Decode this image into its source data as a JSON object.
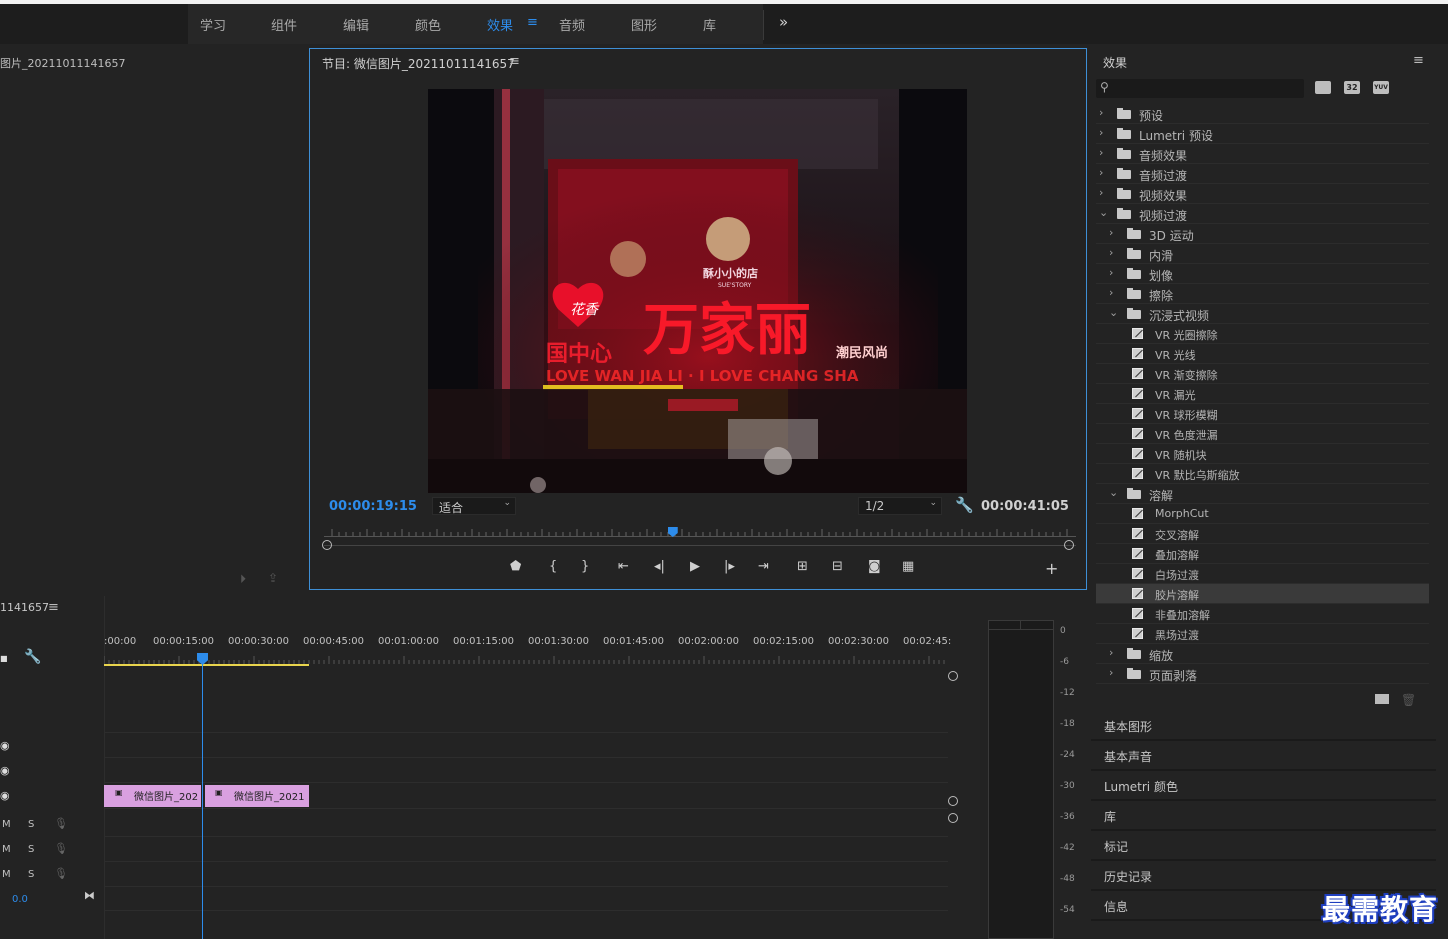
{
  "workspace": {
    "tabs": [
      "学习",
      "组件",
      "编辑",
      "颜色",
      "效果",
      "音频",
      "图形",
      "库"
    ],
    "active_index": 4,
    "overflow_icon": "double-chevron-right"
  },
  "source_panel": {
    "title": "图片_20211011141657"
  },
  "program_monitor": {
    "title": "节目: 微信图片_20211011141657",
    "current_time": "00:00:19:15",
    "fit_option": "适合",
    "resolution": "1/2",
    "duration": "00:00:41:05",
    "playhead_fraction": 0.47
  },
  "video_frame": {
    "sign_main": "万家丽",
    "sign_small": "花香",
    "store_name": "酥小小的店",
    "store_sub": "SUE'STORY",
    "sign_line2": "LOVE WAN JIA LI · I LOVE CHANG SHA",
    "sign_right": "潮民风尚",
    "sign_left": "国中心"
  },
  "effects_panel": {
    "title": "效果",
    "badges": [
      "32",
      "YUV"
    ],
    "tree": [
      {
        "label": "预设",
        "level": 0,
        "type": "preset-folder",
        "expanded": false
      },
      {
        "label": "Lumetri 预设",
        "level": 0,
        "type": "preset-folder",
        "expanded": false
      },
      {
        "label": "音频效果",
        "level": 0,
        "type": "folder",
        "expanded": false
      },
      {
        "label": "音频过渡",
        "level": 0,
        "type": "folder",
        "expanded": false
      },
      {
        "label": "视频效果",
        "level": 0,
        "type": "folder",
        "expanded": false
      },
      {
        "label": "视频过渡",
        "level": 0,
        "type": "folder",
        "expanded": true
      },
      {
        "label": "3D 运动",
        "level": 1,
        "type": "folder",
        "expanded": false
      },
      {
        "label": "内滑",
        "level": 1,
        "type": "folder",
        "expanded": false
      },
      {
        "label": "划像",
        "level": 1,
        "type": "folder",
        "expanded": false
      },
      {
        "label": "擦除",
        "level": 1,
        "type": "folder",
        "expanded": false
      },
      {
        "label": "沉浸式视频",
        "level": 1,
        "type": "folder",
        "expanded": true
      },
      {
        "label": "VR 光圈擦除",
        "level": 2,
        "type": "effect"
      },
      {
        "label": "VR 光线",
        "level": 2,
        "type": "effect"
      },
      {
        "label": "VR 渐变擦除",
        "level": 2,
        "type": "effect"
      },
      {
        "label": "VR 漏光",
        "level": 2,
        "type": "effect"
      },
      {
        "label": "VR 球形模糊",
        "level": 2,
        "type": "effect"
      },
      {
        "label": "VR 色度泄漏",
        "level": 2,
        "type": "effect"
      },
      {
        "label": "VR 随机块",
        "level": 2,
        "type": "effect"
      },
      {
        "label": "VR 默比乌斯缩放",
        "level": 2,
        "type": "effect"
      },
      {
        "label": "溶解",
        "level": 1,
        "type": "folder",
        "expanded": true
      },
      {
        "label": "MorphCut",
        "level": 2,
        "type": "effect"
      },
      {
        "label": "交叉溶解",
        "level": 2,
        "type": "effect"
      },
      {
        "label": "叠加溶解",
        "level": 2,
        "type": "effect"
      },
      {
        "label": "白场过渡",
        "level": 2,
        "type": "effect"
      },
      {
        "label": "胶片溶解",
        "level": 2,
        "type": "effect",
        "selected": true
      },
      {
        "label": "非叠加溶解",
        "level": 2,
        "type": "effect"
      },
      {
        "label": "黑场过渡",
        "level": 2,
        "type": "effect"
      },
      {
        "label": "缩放",
        "level": 1,
        "type": "folder",
        "expanded": false
      },
      {
        "label": "页面剥落",
        "level": 1,
        "type": "folder",
        "expanded": false
      }
    ]
  },
  "stacked_panels": [
    "基本图形",
    "基本声音",
    "Lumetri 颜色",
    "库",
    "标记",
    "历史记录",
    "信息"
  ],
  "timeline": {
    "title": "1141657",
    "ruler_labels": [
      ":00:00",
      "00:00:15:00",
      "00:00:30:00",
      "00:00:45:00",
      "00:01:00:00",
      "00:01:15:00",
      "00:01:30:00",
      "00:01:45:00",
      "00:02:00:00",
      "00:02:15:00",
      "00:02:30:00",
      "00:02:45:"
    ],
    "clips": [
      "微信图片_202",
      "微信图片_2021"
    ],
    "audio_track_letters": [
      "M",
      "S"
    ],
    "volume_value": "0.0"
  },
  "meter": {
    "scale": [
      "0",
      "-6",
      "-12",
      "-18",
      "-24",
      "-30",
      "-36",
      "-42",
      "-48",
      "-54"
    ]
  },
  "watermark": "最需教育",
  "colors": {
    "accent_blue": "#2d8ceb",
    "clip_pink": "#d9a0e0",
    "work_area_yellow": "#e8d44d"
  }
}
